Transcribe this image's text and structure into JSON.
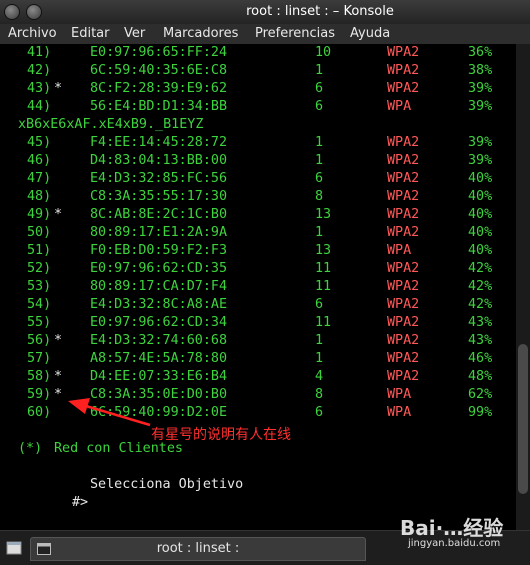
{
  "window": {
    "title": "root : linset : – Konsole",
    "tab_label": "root : linset :"
  },
  "menu": {
    "items": [
      "Archivo",
      "Editar",
      "Ver",
      "Marcadores",
      "Preferencias",
      "Ayuda"
    ]
  },
  "terminal": {
    "rows": [
      {
        "num": "41)",
        "star": "",
        "mac": "E0:97:96:65:FF:24",
        "ch": "10",
        "enc": "WPA2",
        "pwr": "36%"
      },
      {
        "num": "42)",
        "star": "",
        "mac": "6C:59:40:35:6E:C8",
        "ch": "1",
        "enc": "WPA2",
        "pwr": "38%"
      },
      {
        "num": "43)",
        "star": "*",
        "mac": "8C:F2:28:39:E9:62",
        "ch": "6",
        "enc": "WPA2",
        "pwr": "39%"
      },
      {
        "num": "44)",
        "star": "",
        "mac": "56:E4:BD:D1:34:BB",
        "ch": "6",
        "enc": "WPA",
        "pwr": "39%"
      },
      {
        "num": "45)",
        "star": "",
        "mac": "F4:EE:14:45:28:72",
        "ch": "1",
        "enc": "WPA2",
        "pwr": "39%"
      },
      {
        "num": "46)",
        "star": "",
        "mac": "D4:83:04:13:BB:00",
        "ch": "1",
        "enc": "WPA2",
        "pwr": "39%"
      },
      {
        "num": "47)",
        "star": "",
        "mac": "E4:D3:32:85:FC:56",
        "ch": "6",
        "enc": "WPA2",
        "pwr": "40%"
      },
      {
        "num": "48)",
        "star": "",
        "mac": "C8:3A:35:55:17:30",
        "ch": "8",
        "enc": "WPA2",
        "pwr": "40%"
      },
      {
        "num": "49)",
        "star": "*",
        "mac": "8C:AB:8E:2C:1C:B0",
        "ch": "13",
        "enc": "WPA2",
        "pwr": "40%"
      },
      {
        "num": "50)",
        "star": "",
        "mac": "80:89:17:E1:2A:9A",
        "ch": "1",
        "enc": "WPA2",
        "pwr": "40%"
      },
      {
        "num": "51)",
        "star": "",
        "mac": "F0:EB:D0:59:F2:F3",
        "ch": "13",
        "enc": "WPA",
        "pwr": "40%"
      },
      {
        "num": "52)",
        "star": "",
        "mac": "E0:97:96:62:CD:35",
        "ch": "11",
        "enc": "WPA2",
        "pwr": "42%"
      },
      {
        "num": "53)",
        "star": "",
        "mac": "80:89:17:CA:D7:F4",
        "ch": "11",
        "enc": "WPA2",
        "pwr": "42%"
      },
      {
        "num": "54)",
        "star": "",
        "mac": "E4:D3:32:8C:A8:AE",
        "ch": "6",
        "enc": "WPA2",
        "pwr": "42%"
      },
      {
        "num": "55)",
        "star": "",
        "mac": "E0:97:96:62:CD:34",
        "ch": "11",
        "enc": "WPA2",
        "pwr": "43%"
      },
      {
        "num": "56)",
        "star": "*",
        "mac": "E4:D3:32:74:60:68",
        "ch": "1",
        "enc": "WPA2",
        "pwr": "43%"
      },
      {
        "num": "57)",
        "star": "",
        "mac": "A8:57:4E:5A:78:80",
        "ch": "1",
        "enc": "WPA2",
        "pwr": "46%"
      },
      {
        "num": "58)",
        "star": "*",
        "mac": "D4:EE:07:33:E6:B4",
        "ch": "4",
        "enc": "WPA2",
        "pwr": "48%"
      },
      {
        "num": "59)",
        "star": "*",
        "mac": "C8:3A:35:0E:D0:B0",
        "ch": "8",
        "enc": "WPA",
        "pwr": "62%"
      },
      {
        "num": "60)",
        "star": "",
        "mac": "6C:59:40:99:D2:0E",
        "ch": "6",
        "enc": "WPA",
        "pwr": "99%"
      }
    ],
    "essid_line": "xB6xE6xAF.xE4xB9._B1EYZ",
    "legend_prefix": "(*) ",
    "legend_label": "Red con Clientes",
    "select_prompt": "Selecciona Objetivo",
    "input_prompt": "#>"
  },
  "annotation": {
    "text": "有星号的说明有人在线",
    "color": "#ff3030"
  },
  "watermark": {
    "brand": "Bai·…经验",
    "url": "jingyan.baidu.com"
  },
  "colors": {
    "terminal_green": "#3ed33e",
    "terminal_red": "#ff5858",
    "background": "#000000"
  }
}
